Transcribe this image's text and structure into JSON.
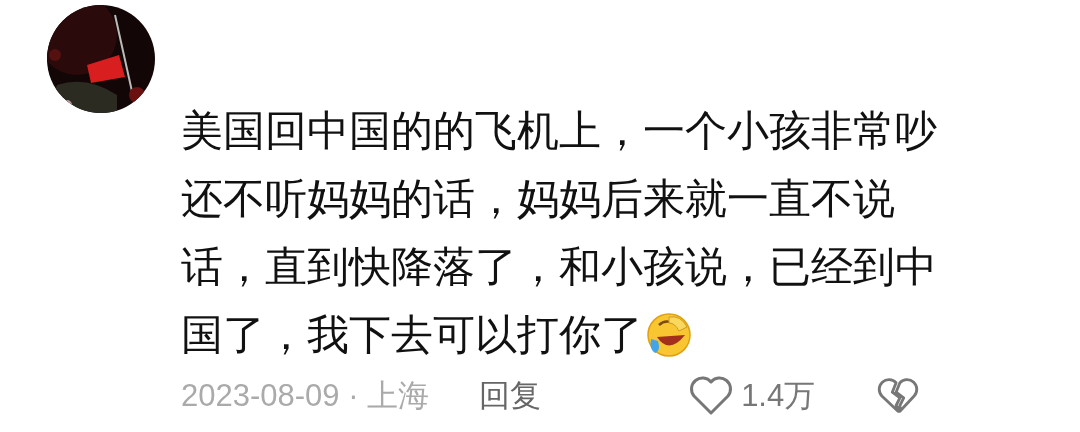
{
  "comment": {
    "text_lines": [
      "美国回中国的的飞机上，一个小孩非常吵",
      "还不听妈妈的话，妈妈后来就一直不说",
      "话，直到快降落了，和小孩说，已经到中",
      "国了，我下去可以打你了"
    ],
    "date_location": "2023-08-09 · 上海",
    "reply": "回复",
    "likes": "1.4万"
  }
}
